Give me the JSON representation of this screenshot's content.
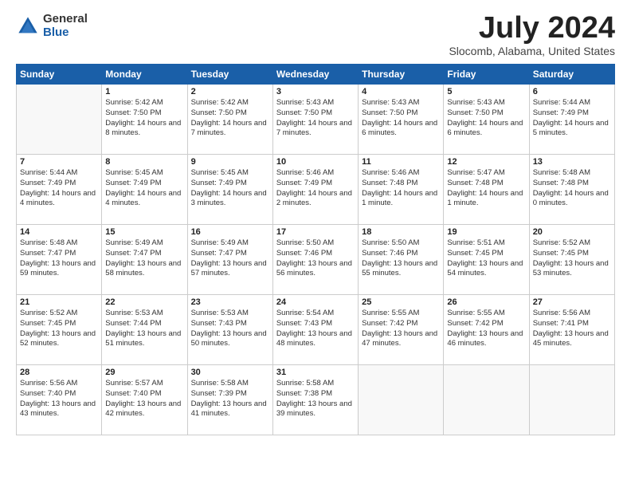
{
  "header": {
    "logo_general": "General",
    "logo_blue": "Blue",
    "month_title": "July 2024",
    "location": "Slocomb, Alabama, United States"
  },
  "weekdays": [
    "Sunday",
    "Monday",
    "Tuesday",
    "Wednesday",
    "Thursday",
    "Friday",
    "Saturday"
  ],
  "weeks": [
    [
      {
        "day": "",
        "empty": true
      },
      {
        "day": "1",
        "sunrise": "Sunrise: 5:42 AM",
        "sunset": "Sunset: 7:50 PM",
        "daylight": "Daylight: 14 hours and 8 minutes."
      },
      {
        "day": "2",
        "sunrise": "Sunrise: 5:42 AM",
        "sunset": "Sunset: 7:50 PM",
        "daylight": "Daylight: 14 hours and 7 minutes."
      },
      {
        "day": "3",
        "sunrise": "Sunrise: 5:43 AM",
        "sunset": "Sunset: 7:50 PM",
        "daylight": "Daylight: 14 hours and 7 minutes."
      },
      {
        "day": "4",
        "sunrise": "Sunrise: 5:43 AM",
        "sunset": "Sunset: 7:50 PM",
        "daylight": "Daylight: 14 hours and 6 minutes."
      },
      {
        "day": "5",
        "sunrise": "Sunrise: 5:43 AM",
        "sunset": "Sunset: 7:50 PM",
        "daylight": "Daylight: 14 hours and 6 minutes."
      },
      {
        "day": "6",
        "sunrise": "Sunrise: 5:44 AM",
        "sunset": "Sunset: 7:49 PM",
        "daylight": "Daylight: 14 hours and 5 minutes."
      }
    ],
    [
      {
        "day": "7",
        "sunrise": "Sunrise: 5:44 AM",
        "sunset": "Sunset: 7:49 PM",
        "daylight": "Daylight: 14 hours and 4 minutes."
      },
      {
        "day": "8",
        "sunrise": "Sunrise: 5:45 AM",
        "sunset": "Sunset: 7:49 PM",
        "daylight": "Daylight: 14 hours and 4 minutes."
      },
      {
        "day": "9",
        "sunrise": "Sunrise: 5:45 AM",
        "sunset": "Sunset: 7:49 PM",
        "daylight": "Daylight: 14 hours and 3 minutes."
      },
      {
        "day": "10",
        "sunrise": "Sunrise: 5:46 AM",
        "sunset": "Sunset: 7:49 PM",
        "daylight": "Daylight: 14 hours and 2 minutes."
      },
      {
        "day": "11",
        "sunrise": "Sunrise: 5:46 AM",
        "sunset": "Sunset: 7:48 PM",
        "daylight": "Daylight: 14 hours and 1 minute."
      },
      {
        "day": "12",
        "sunrise": "Sunrise: 5:47 AM",
        "sunset": "Sunset: 7:48 PM",
        "daylight": "Daylight: 14 hours and 1 minute."
      },
      {
        "day": "13",
        "sunrise": "Sunrise: 5:48 AM",
        "sunset": "Sunset: 7:48 PM",
        "daylight": "Daylight: 14 hours and 0 minutes."
      }
    ],
    [
      {
        "day": "14",
        "sunrise": "Sunrise: 5:48 AM",
        "sunset": "Sunset: 7:47 PM",
        "daylight": "Daylight: 13 hours and 59 minutes."
      },
      {
        "day": "15",
        "sunrise": "Sunrise: 5:49 AM",
        "sunset": "Sunset: 7:47 PM",
        "daylight": "Daylight: 13 hours and 58 minutes."
      },
      {
        "day": "16",
        "sunrise": "Sunrise: 5:49 AM",
        "sunset": "Sunset: 7:47 PM",
        "daylight": "Daylight: 13 hours and 57 minutes."
      },
      {
        "day": "17",
        "sunrise": "Sunrise: 5:50 AM",
        "sunset": "Sunset: 7:46 PM",
        "daylight": "Daylight: 13 hours and 56 minutes."
      },
      {
        "day": "18",
        "sunrise": "Sunrise: 5:50 AM",
        "sunset": "Sunset: 7:46 PM",
        "daylight": "Daylight: 13 hours and 55 minutes."
      },
      {
        "day": "19",
        "sunrise": "Sunrise: 5:51 AM",
        "sunset": "Sunset: 7:45 PM",
        "daylight": "Daylight: 13 hours and 54 minutes."
      },
      {
        "day": "20",
        "sunrise": "Sunrise: 5:52 AM",
        "sunset": "Sunset: 7:45 PM",
        "daylight": "Daylight: 13 hours and 53 minutes."
      }
    ],
    [
      {
        "day": "21",
        "sunrise": "Sunrise: 5:52 AM",
        "sunset": "Sunset: 7:45 PM",
        "daylight": "Daylight: 13 hours and 52 minutes."
      },
      {
        "day": "22",
        "sunrise": "Sunrise: 5:53 AM",
        "sunset": "Sunset: 7:44 PM",
        "daylight": "Daylight: 13 hours and 51 minutes."
      },
      {
        "day": "23",
        "sunrise": "Sunrise: 5:53 AM",
        "sunset": "Sunset: 7:43 PM",
        "daylight": "Daylight: 13 hours and 50 minutes."
      },
      {
        "day": "24",
        "sunrise": "Sunrise: 5:54 AM",
        "sunset": "Sunset: 7:43 PM",
        "daylight": "Daylight: 13 hours and 48 minutes."
      },
      {
        "day": "25",
        "sunrise": "Sunrise: 5:55 AM",
        "sunset": "Sunset: 7:42 PM",
        "daylight": "Daylight: 13 hours and 47 minutes."
      },
      {
        "day": "26",
        "sunrise": "Sunrise: 5:55 AM",
        "sunset": "Sunset: 7:42 PM",
        "daylight": "Daylight: 13 hours and 46 minutes."
      },
      {
        "day": "27",
        "sunrise": "Sunrise: 5:56 AM",
        "sunset": "Sunset: 7:41 PM",
        "daylight": "Daylight: 13 hours and 45 minutes."
      }
    ],
    [
      {
        "day": "28",
        "sunrise": "Sunrise: 5:56 AM",
        "sunset": "Sunset: 7:40 PM",
        "daylight": "Daylight: 13 hours and 43 minutes."
      },
      {
        "day": "29",
        "sunrise": "Sunrise: 5:57 AM",
        "sunset": "Sunset: 7:40 PM",
        "daylight": "Daylight: 13 hours and 42 minutes."
      },
      {
        "day": "30",
        "sunrise": "Sunrise: 5:58 AM",
        "sunset": "Sunset: 7:39 PM",
        "daylight": "Daylight: 13 hours and 41 minutes."
      },
      {
        "day": "31",
        "sunrise": "Sunrise: 5:58 AM",
        "sunset": "Sunset: 7:38 PM",
        "daylight": "Daylight: 13 hours and 39 minutes."
      },
      {
        "day": "",
        "empty": true
      },
      {
        "day": "",
        "empty": true
      },
      {
        "day": "",
        "empty": true
      }
    ]
  ]
}
